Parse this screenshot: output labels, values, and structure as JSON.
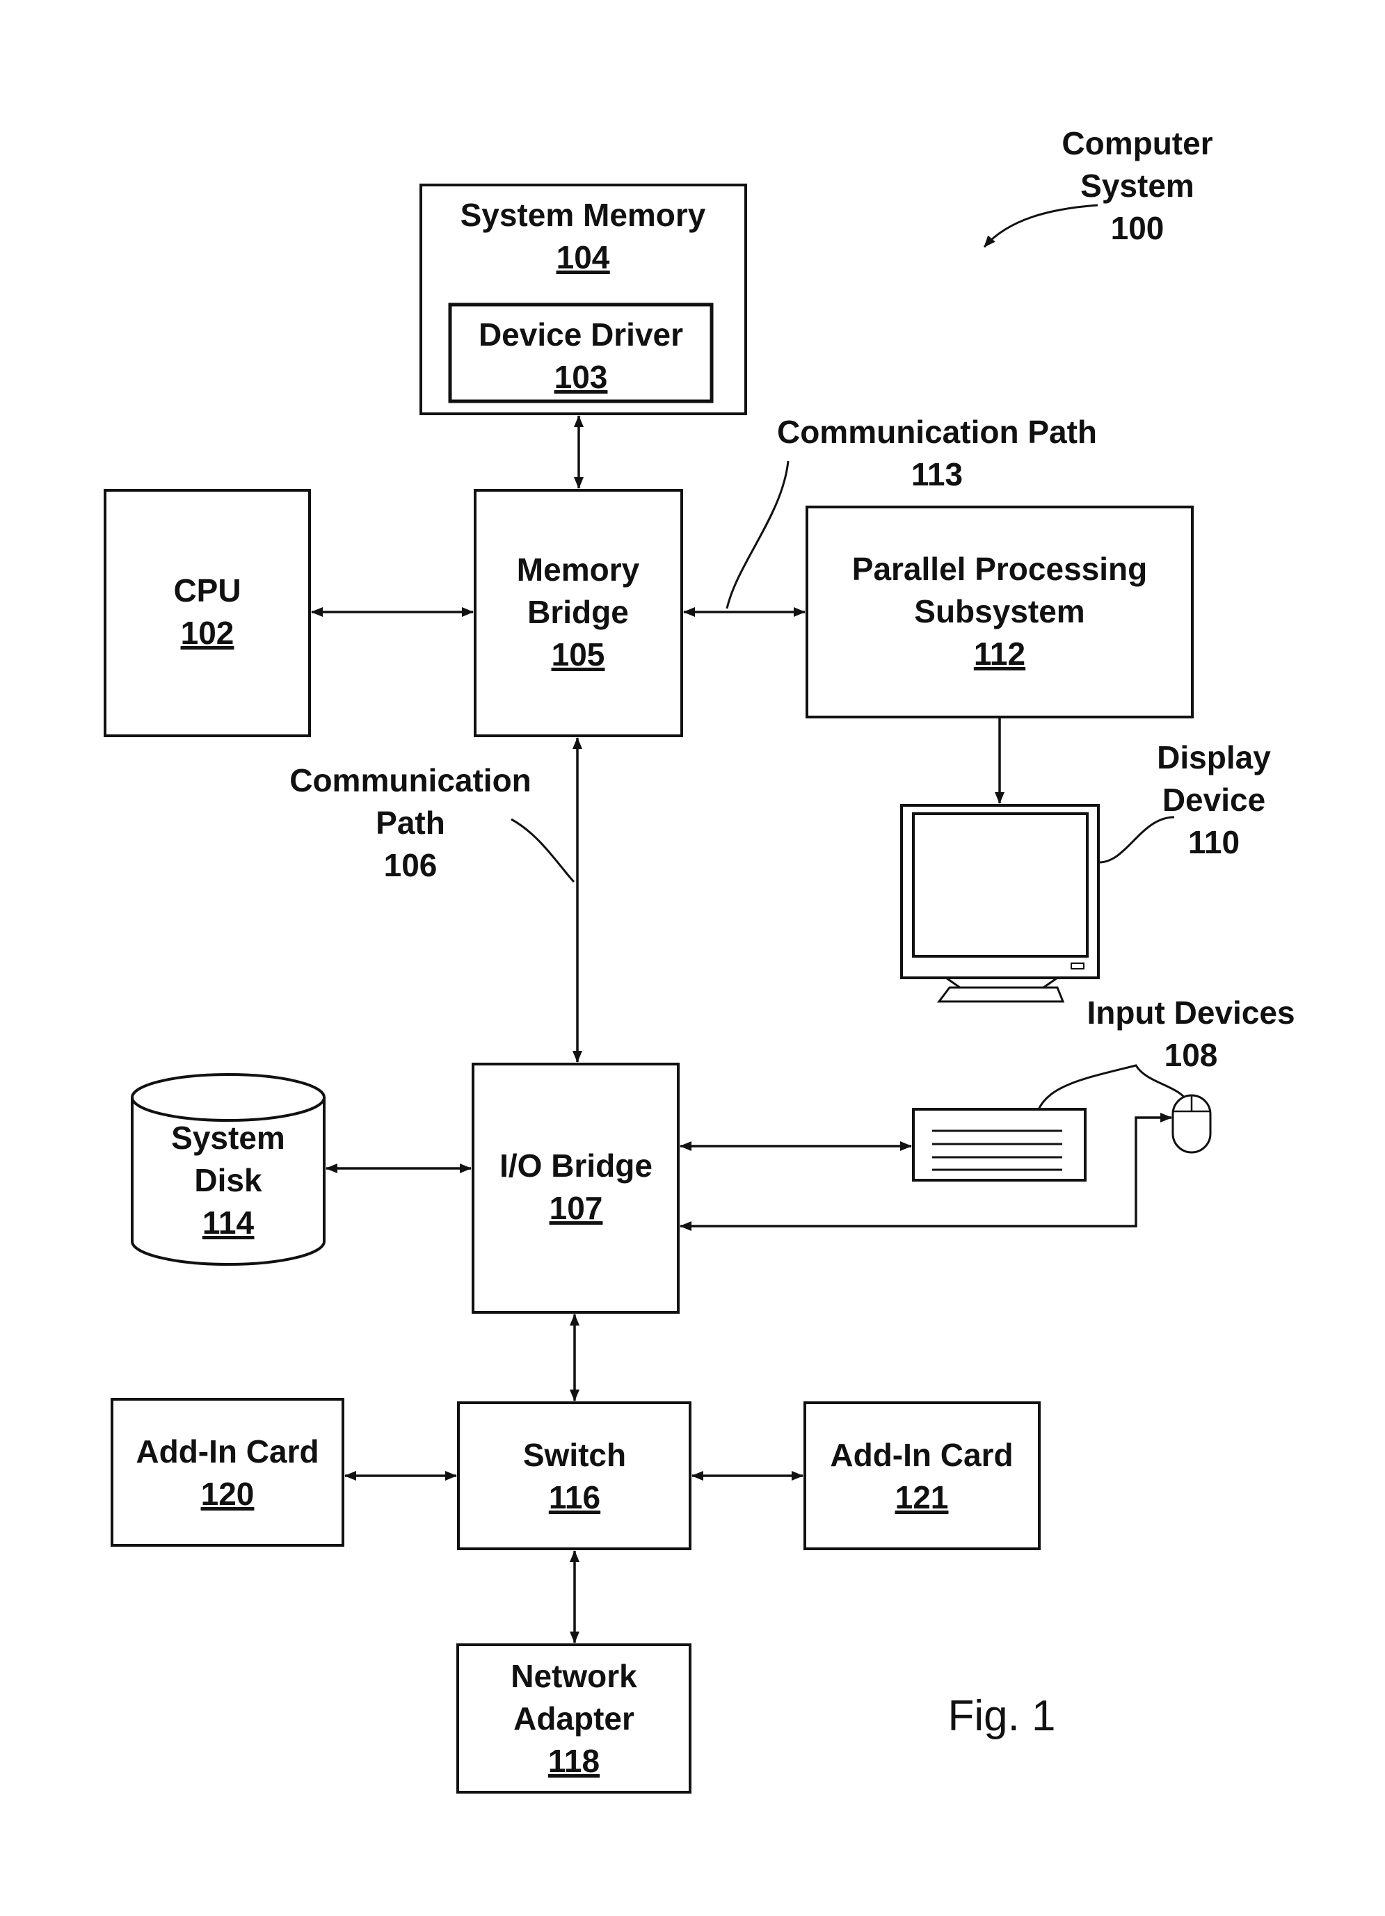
{
  "figure": {
    "caption": "Fig. 1",
    "system_label": {
      "line1": "Computer",
      "line2": "System",
      "ref": "100"
    }
  },
  "blocks": {
    "system_memory": {
      "label": "System Memory",
      "ref": "104"
    },
    "device_driver": {
      "label": "Device Driver",
      "ref": "103"
    },
    "cpu": {
      "label": "CPU",
      "ref": "102"
    },
    "memory_bridge": {
      "line1": "Memory",
      "line2": "Bridge",
      "ref": "105"
    },
    "parallel_processing": {
      "line1": "Parallel Processing",
      "line2": "Subsystem",
      "ref": "112"
    },
    "display_device": {
      "line1": "Display",
      "line2": "Device",
      "ref": "110"
    },
    "input_devices": {
      "label": "Input Devices",
      "ref": "108"
    },
    "io_bridge": {
      "label": "I/O Bridge",
      "ref": "107"
    },
    "system_disk": {
      "line1": "System",
      "line2": "Disk",
      "ref": "114"
    },
    "switch": {
      "label": "Switch",
      "ref": "116"
    },
    "add_in_card_left": {
      "label": "Add-In Card",
      "ref": "120"
    },
    "add_in_card_right": {
      "label": "Add-In Card",
      "ref": "121"
    },
    "network_adapter": {
      "line1": "Network",
      "line2": "Adapter",
      "ref": "118"
    }
  },
  "paths": {
    "comm_path_113": {
      "line1": "Communication Path",
      "ref": "113"
    },
    "comm_path_106": {
      "line1": "Communication",
      "line2": "Path",
      "ref": "106"
    }
  }
}
